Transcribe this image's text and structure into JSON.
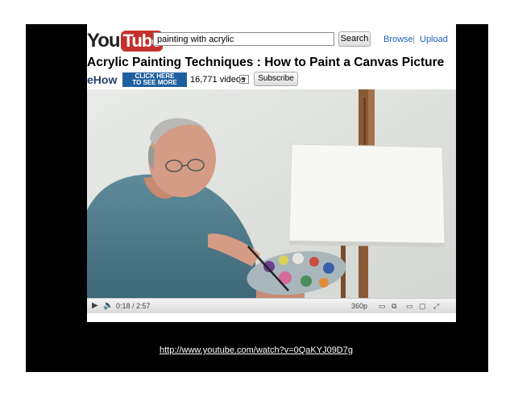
{
  "header": {
    "logo_you": "You",
    "logo_tube": "Tube",
    "search_value": "painting with acrylic",
    "search_button": "Search",
    "nav_browse": "Browse",
    "nav_separator": "|",
    "nav_upload": "Upload"
  },
  "video": {
    "title": "Acrylic Painting Techniques : How to Paint a Canvas Picture"
  },
  "channel": {
    "logo": "eHow",
    "cta_line1": "CLICK HERE",
    "cta_line2": "TO SEE MORE",
    "videos_count": "16,771 videos",
    "subscribe_label": "Subscribe"
  },
  "player": {
    "time": "0:18 / 2:57",
    "quality": "360p",
    "progress_fraction": 0.1
  },
  "footer": {
    "url": "http://www.youtube.com/watch?v=0QaKYJ09D7g"
  },
  "colors": {
    "youtube_red": "#c4302b",
    "link_blue": "#1c62b9",
    "ehow_blue": "#1f5fa0",
    "slide_background": "#000000"
  }
}
